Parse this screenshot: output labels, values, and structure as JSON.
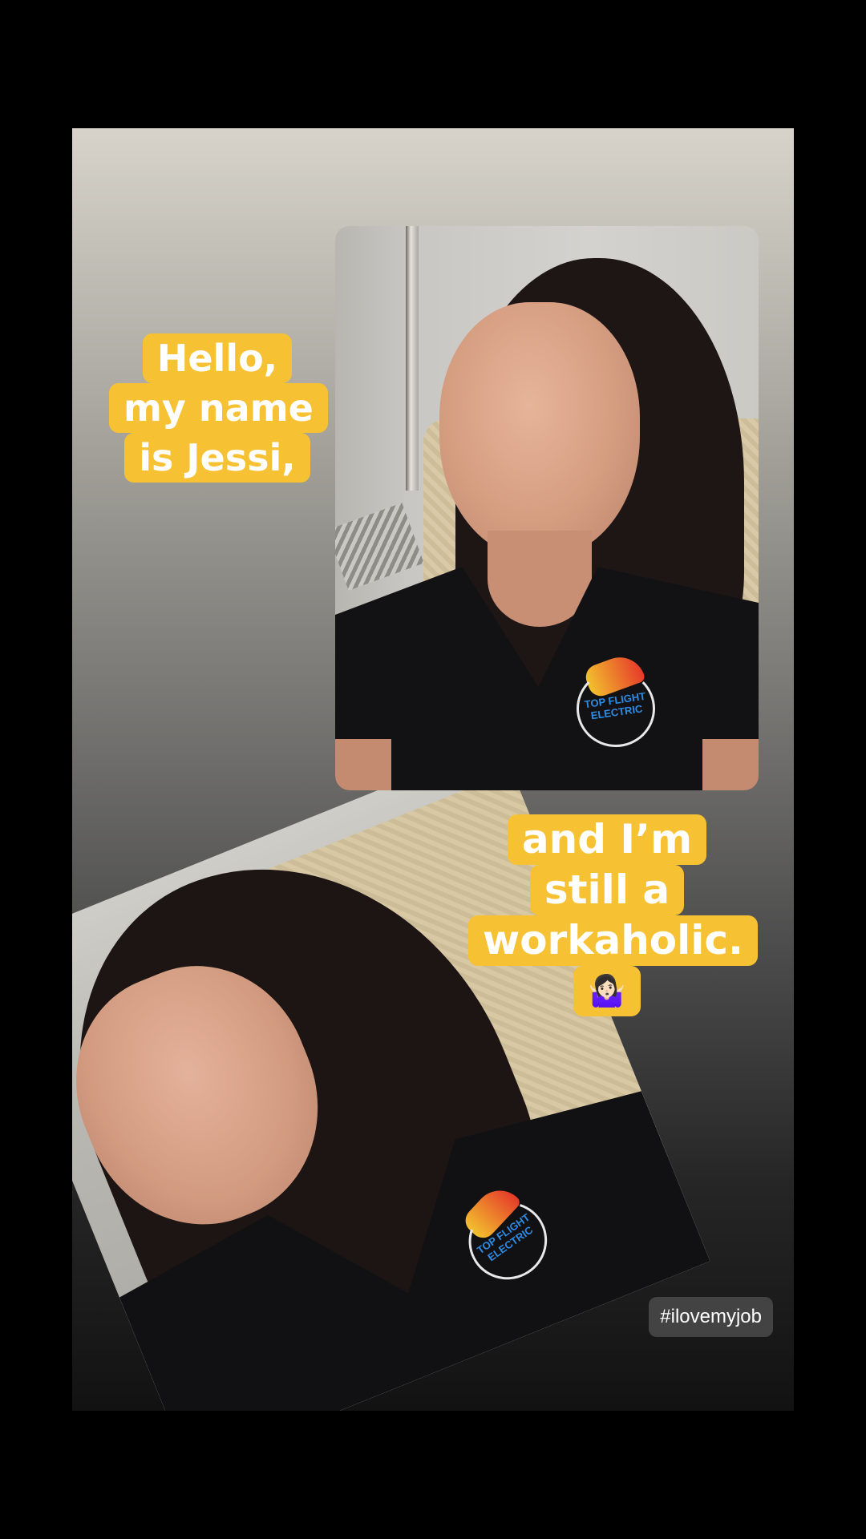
{
  "story": {
    "sticker_top": {
      "line1": "Hello,",
      "line2": "my name",
      "line3": "is Jessi,"
    },
    "sticker_bottom": {
      "line1": "and I’m",
      "line2": "still a",
      "line3": "workaholic.",
      "emoji": "🤷🏻‍♀️"
    },
    "hashtag": "#ilovemyjob",
    "logo_text": {
      "line1": "TOP FLIGHT",
      "line2": "ELECTRIC"
    },
    "colors": {
      "sticker_bg": "#f6c234",
      "hashtag_bg": "#464648",
      "shirt_logo_text": "#2c8ce6"
    }
  }
}
